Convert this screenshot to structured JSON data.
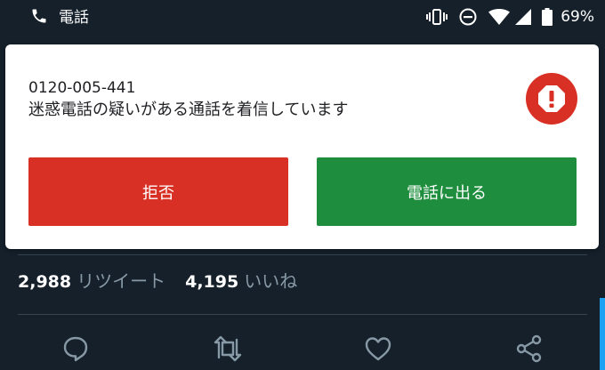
{
  "status_bar": {
    "app_label": "電話",
    "battery_percent": "69%",
    "icons": [
      "phone-icon",
      "vibrate-icon",
      "do-not-disturb-icon",
      "wifi-icon",
      "cell-signal-icon",
      "battery-icon"
    ]
  },
  "call_notification": {
    "phone_number": "0120-005-441",
    "description": "迷惑電話の疑いがある通話を着信しています",
    "warning_icon": "alert-icon",
    "decline_label": "拒否",
    "answer_label": "電話に出る",
    "colors": {
      "decline": "#d93025",
      "answer": "#1e8e3e",
      "warning": "#d93025"
    }
  },
  "tweet": {
    "retweets": {
      "count": "2,988",
      "label": "リツイート"
    },
    "likes": {
      "count": "4,195",
      "label": "いいね"
    },
    "actions": [
      "reply-icon",
      "retweet-icon",
      "like-icon",
      "share-icon"
    ]
  },
  "theme": {
    "background": "#15202b",
    "muted_text": "#8899a6",
    "accent": "#1da1f2"
  }
}
